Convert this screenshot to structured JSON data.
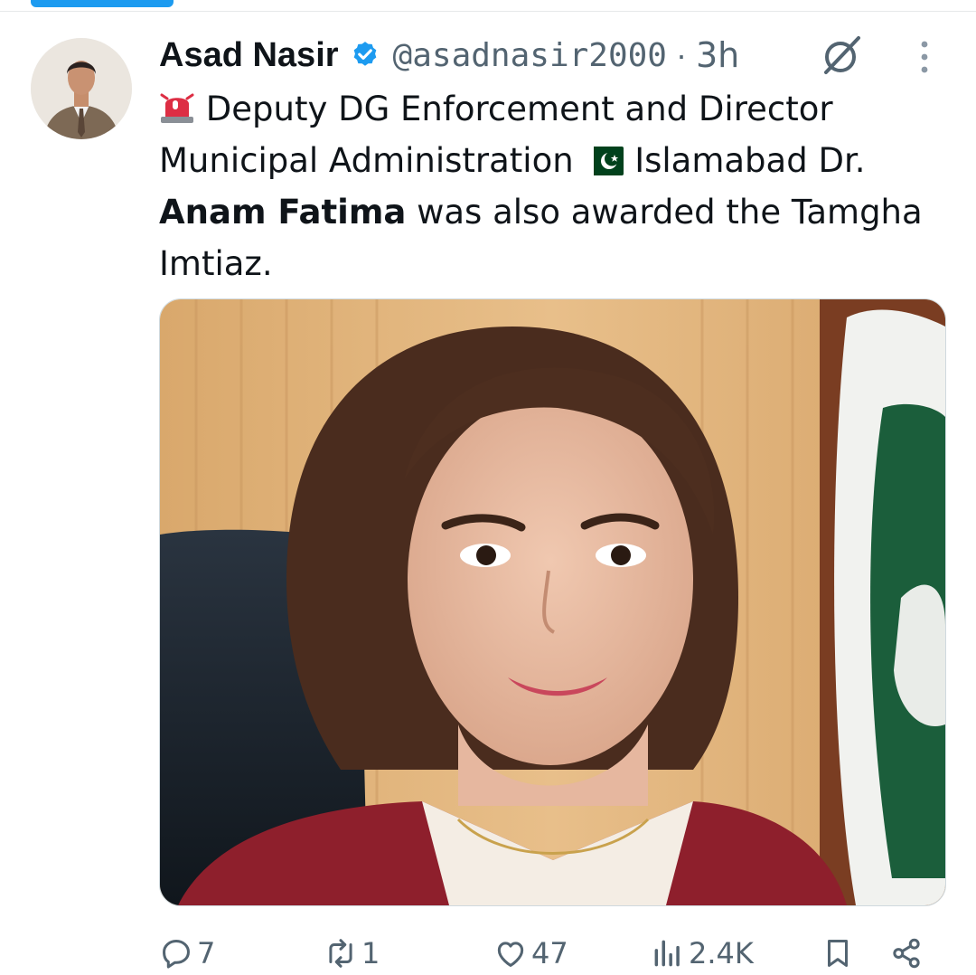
{
  "tweet": {
    "author_name": "Asad Nasir",
    "handle": "@asadnasir2000",
    "separator": "·",
    "time": "3h",
    "text_part1": " Deputy DG Enforcement and Director Municipal Administration ",
    "text_part2": " Islamabad Dr. ",
    "text_bold": "Anam Fatima",
    "text_part3": " was also awarded the Tamgha Imtiaz.",
    "emoji_1": "police-light-icon",
    "emoji_2": "pakistan-flag-icon"
  },
  "actions": {
    "replies": "7",
    "reposts": "1",
    "likes": "47",
    "views": "2.4K"
  },
  "colors": {
    "accent": "#1d9bf0",
    "text": "#0f1419",
    "muted": "#536471"
  }
}
